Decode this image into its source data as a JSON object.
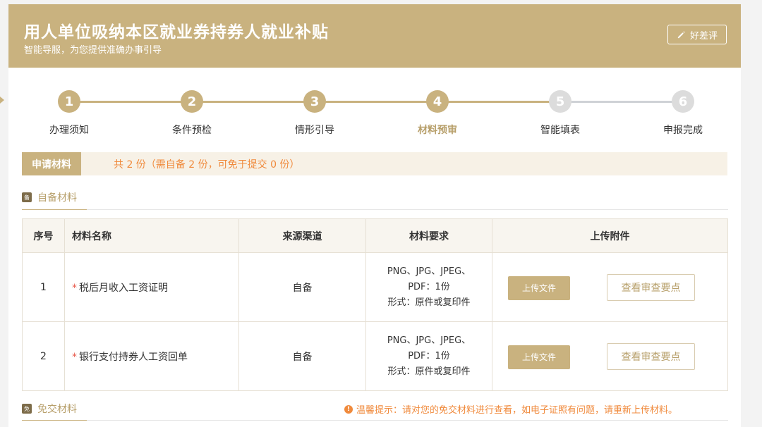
{
  "header": {
    "title": "用人单位吸纳本区就业券持券人就业补贴",
    "subtitle": "智能导服，为您提供准确办事引导",
    "rate_label": "好差评"
  },
  "steps": [
    {
      "num": "1",
      "label": "办理须知",
      "state": "done"
    },
    {
      "num": "2",
      "label": "条件预检",
      "state": "done"
    },
    {
      "num": "3",
      "label": "情形引导",
      "state": "done"
    },
    {
      "num": "4",
      "label": "材料预审",
      "state": "active"
    },
    {
      "num": "5",
      "label": "智能填表",
      "state": "todo"
    },
    {
      "num": "6",
      "label": "申报完成",
      "state": "todo"
    }
  ],
  "materials_bar": {
    "tag": "申请材料",
    "summary": "共 2 份（需自备 2 份，可免于提交 0 份）"
  },
  "self_section": {
    "title": "自备材料",
    "icon_char": "备"
  },
  "exempt_section": {
    "title": "免交材料",
    "icon_char": "免"
  },
  "table": {
    "headers": [
      "序号",
      "材料名称",
      "来源渠道",
      "材料要求",
      "上传附件"
    ],
    "rows": [
      {
        "index": "1",
        "name": "税后月收入工资证明",
        "source": "自备",
        "req_line1": "PNG、JPG、JPEG、",
        "req_line2": "PDF：1份",
        "req_line3": "形式：原件或复印件",
        "upload_label": "上传文件",
        "review_label": "查看审查要点"
      },
      {
        "index": "2",
        "name": "银行支付持券人工资回单",
        "source": "自备",
        "req_line1": "PNG、JPG、JPEG、",
        "req_line2": "PDF：1份",
        "req_line3": "形式：原件或复印件",
        "upload_label": "上传文件",
        "review_label": "查看审查要点"
      }
    ]
  },
  "tip": {
    "icon": "!",
    "text": "温馨提示：请对您的免交材料进行查看，如电子证照有问题，请重新上传材料。"
  },
  "colors": {
    "gold": "#c9b27f",
    "gold_text": "#b79f6a",
    "inactive": "#dcdcdc",
    "orange": "#f08a3c",
    "required": "#e8584a"
  }
}
